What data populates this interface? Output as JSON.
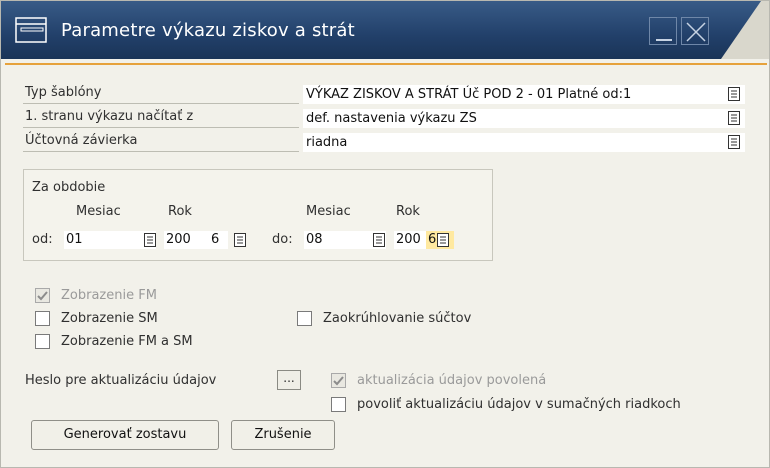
{
  "window": {
    "title": "Parametre výkazu ziskov a strát"
  },
  "form": {
    "template_type": {
      "label": "Typ šablóny",
      "value": "VÝKAZ ZISKOV A STRÁT Úč POD 2 - 01 Platné od:1"
    },
    "first_page": {
      "label": "1. stranu výkazu načítať z",
      "value": "def. nastavenia výkazu ZS"
    },
    "closing": {
      "label": "Účtovná závierka",
      "value": "riadna"
    }
  },
  "period": {
    "group_label": "Za obdobie",
    "month_header": "Mesiac",
    "year_header": "Rok",
    "from_label": "od:",
    "to_label": "do:",
    "from_month": "01",
    "from_year": "200",
    "from_year_digit": "6",
    "to_month": "08",
    "to_year": "200",
    "to_year_digit": "6"
  },
  "checkboxes": {
    "show_fm": {
      "label": "Zobrazenie FM",
      "checked": true,
      "disabled": true
    },
    "show_sm": {
      "label": "Zobrazenie SM",
      "checked": false
    },
    "show_fm_sm": {
      "label": "Zobrazenie FM a SM",
      "checked": false
    },
    "rounding": {
      "label": "Zaokrúhlovanie súčtov",
      "checked": false
    },
    "update_allowed": {
      "label": "aktualizácia údajov povolená",
      "checked": true,
      "disabled": true
    },
    "allow_sum_rows": {
      "label": "povoliť aktualizáciu údajov v sumačných riadkoch",
      "checked": false
    }
  },
  "password": {
    "label": "Heslo pre aktualizáciu údajov",
    "button_label": "..."
  },
  "buttons": {
    "generate": "Generovať zostavu",
    "cancel": "Zrušenie"
  },
  "colors": {
    "title_bar": "#2c4a74",
    "accent": "#e6a23c",
    "highlight": "#ffe9a0"
  }
}
